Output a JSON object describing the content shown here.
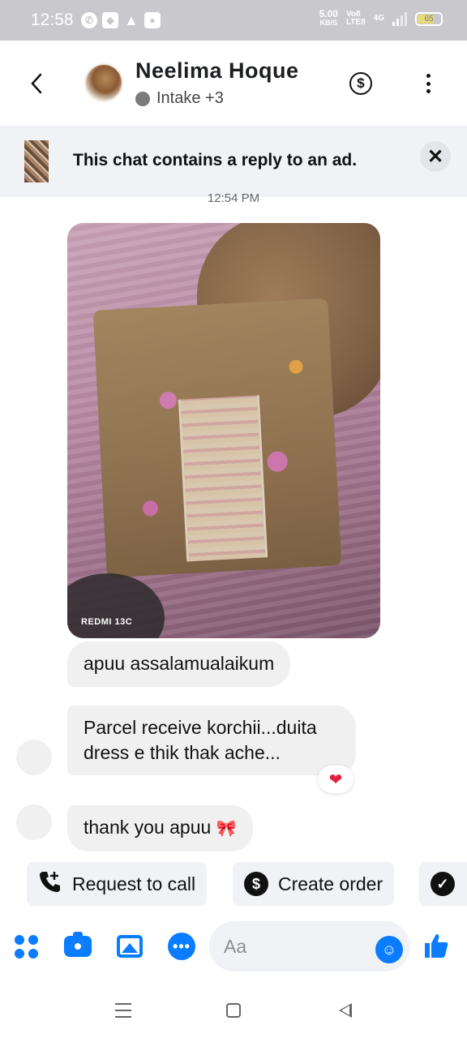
{
  "status_bar": {
    "time": "12:58",
    "speed_value": "5.00",
    "speed_unit": "KB/S",
    "network_1": "Vo8",
    "network_2": "LTE8",
    "network_3": "4G",
    "battery_level": "65"
  },
  "header": {
    "contact_name": "Neelima Hoque",
    "subtitle": "Intake +3"
  },
  "ad_banner": {
    "text": "This chat contains a reply to an ad."
  },
  "timestamp": "12:54 PM",
  "photo": {
    "watermark": "REDMI 13C"
  },
  "messages": [
    {
      "text": "apuu assalamualaikum"
    },
    {
      "text_line1": "Parcel receive korchii...duita",
      "text_line2": "dress e thik thak ache..."
    },
    {
      "text": "thank you apuu",
      "emoji": "🎀"
    }
  ],
  "reaction": "❤",
  "quick_actions": [
    {
      "label": "Request to call",
      "icon": "phone-plus-icon"
    },
    {
      "label": "Create order",
      "icon": "dollar-icon"
    },
    {
      "label": "",
      "icon": "check-circle-icon"
    }
  ],
  "composer": {
    "placeholder": "Aa"
  },
  "colors": {
    "messenger_blue": "#0a7cff",
    "bubble_gray": "#f0f0f0",
    "banner_gray": "#f0f2f5",
    "status_bar": "#c9c9cd"
  }
}
